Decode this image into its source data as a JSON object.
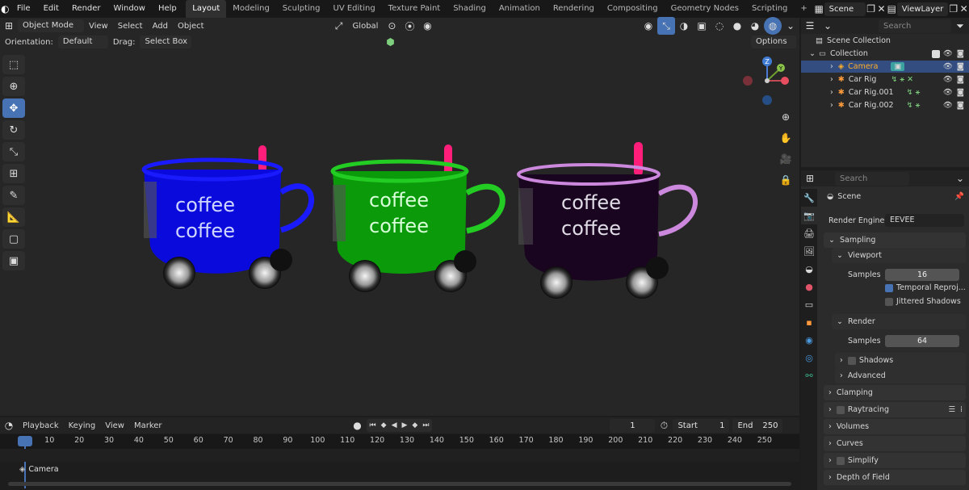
{
  "menubar": {
    "items": [
      "File",
      "Edit",
      "Render",
      "Window",
      "Help"
    ]
  },
  "workspaces": [
    "Layout",
    "Modeling",
    "Sculpting",
    "UV Editing",
    "Texture Paint",
    "Shading",
    "Animation",
    "Rendering",
    "Compositing",
    "Geometry Nodes",
    "Scripting"
  ],
  "workspace_add": "+",
  "scene": {
    "label": "Scene",
    "viewlayer": "ViewLayer"
  },
  "viewport": {
    "mode": "Object Mode",
    "menus": [
      "View",
      "Select",
      "Add",
      "Object"
    ],
    "transform_orientation": "Global",
    "orientation_label": "Orientation:",
    "orientation_value": "Default",
    "drag_label": "Drag:",
    "drag_value": "Select Box",
    "options": "Options"
  },
  "cups": [
    {
      "color": "#0a0adc",
      "rim": "#1a1aff",
      "text1": "coffee",
      "text2": "coffee"
    },
    {
      "color": "#0a9a0a",
      "rim": "#22cc22",
      "text1": "coffee",
      "text2": "coffee"
    },
    {
      "color": "#1a0520",
      "rim": "#cc88dd",
      "text1": "coffee",
      "text2": "coffee"
    }
  ],
  "gizmo": {
    "z": "Z",
    "y": "Y"
  },
  "timeline": {
    "menus": [
      "Playback",
      "Keying",
      "View",
      "Marker"
    ],
    "current_frame": "1",
    "start_label": "Start",
    "start": "1",
    "end_label": "End",
    "end": "250",
    "ruler": [
      "1",
      "10",
      "20",
      "30",
      "40",
      "50",
      "60",
      "70",
      "80",
      "90",
      "100",
      "110",
      "120",
      "130",
      "140",
      "150",
      "160",
      "170",
      "180",
      "190",
      "200",
      "210",
      "220",
      "230",
      "240",
      "250"
    ],
    "track": "Camera"
  },
  "outliner": {
    "search_placeholder": "Search",
    "scene_collection": "Scene Collection",
    "collection": "Collection",
    "items": [
      "Camera",
      "Car Rig",
      "Car Rig.001",
      "Car Rig.002"
    ]
  },
  "properties": {
    "search_placeholder": "Search",
    "scene": "Scene",
    "render_engine_label": "Render Engine",
    "render_engine": "EEVEE",
    "sampling": "Sampling",
    "viewport": "Viewport",
    "samples_label": "Samples",
    "viewport_samples": "16",
    "temporal": "Temporal Reproj...",
    "jittered": "Jittered Shadows",
    "render": "Render",
    "render_samples_label": "Samples",
    "render_samples": "64",
    "shadows": "Shadows",
    "advanced": "Advanced",
    "clamping": "Clamping",
    "raytracing": "Raytracing",
    "volumes": "Volumes",
    "curves": "Curves",
    "simplify": "Simplify",
    "dof": "Depth of Field"
  },
  "colors": {
    "accent": "#4772b3",
    "selected_row": "#334d80",
    "camera_text": "#ffaf29"
  }
}
